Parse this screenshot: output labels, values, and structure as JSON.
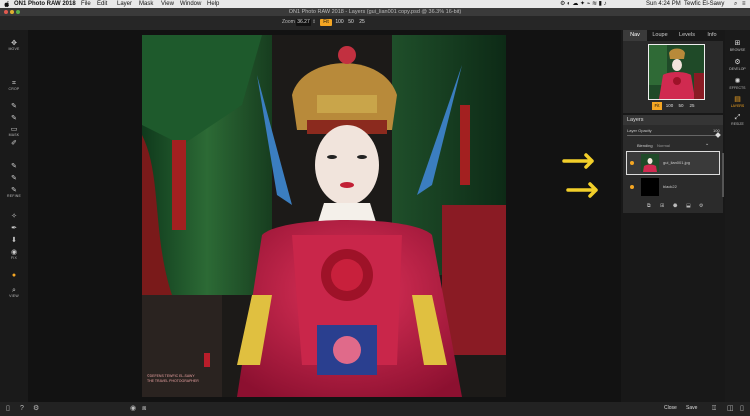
{
  "menubar": {
    "app": "ON1 Photo RAW 2018",
    "items": [
      "File",
      "Edit",
      "Layer",
      "Mask",
      "View",
      "Window",
      "Help"
    ],
    "clock": "Sun 4:24 PM",
    "user": "Tewfic El-Sawy"
  },
  "window": {
    "title": "ON1 Photo RAW 2018 - Layers (gui_lian001 copy.psd @ 36.3% 16-bit)"
  },
  "zoom": {
    "label": "Zoom",
    "value": "36.27",
    "fit": "Fit",
    "presets": [
      "100",
      "50",
      "25"
    ]
  },
  "tools": [
    {
      "glyph": "✥",
      "label": "MOVE"
    },
    {
      "glyph": "⌗",
      "label": "CROP"
    },
    {
      "glyph": "✎",
      "label": ""
    },
    {
      "glyph": "✎",
      "label": ""
    },
    {
      "glyph": "▭",
      "label": "MASK"
    },
    {
      "glyph": "✐",
      "label": ""
    },
    {
      "glyph": "✎",
      "label": ""
    },
    {
      "glyph": "✎",
      "label": ""
    },
    {
      "glyph": "✎",
      "label": "REFINE"
    },
    {
      "glyph": "✧",
      "label": ""
    },
    {
      "glyph": "✒",
      "label": ""
    },
    {
      "glyph": "⬇",
      "label": ""
    },
    {
      "glyph": "◉",
      "label": "FIX"
    },
    {
      "glyph": "●",
      "label": ""
    },
    {
      "glyph": "⌕",
      "label": "VIEW"
    }
  ],
  "panel": {
    "tabs": [
      "Nav",
      "Loupe",
      "Levels",
      "Info"
    ],
    "nav_zoom": [
      "Fit",
      "100",
      "50",
      "25"
    ],
    "layers_title": "Layers",
    "layer_opacity_label": "Layer Opacity",
    "layer_opacity_value": "100",
    "blending_label": "Blending",
    "blending_value": "Normal",
    "layers": [
      {
        "name": "gui_lian001.jpg"
      },
      {
        "name": "black22"
      }
    ]
  },
  "modules": [
    {
      "glyph": "⊞",
      "label": "BROWSE"
    },
    {
      "glyph": "⚙",
      "label": "DEVELOP"
    },
    {
      "glyph": "✺",
      "label": "EFFECTS"
    },
    {
      "glyph": "▤",
      "label": "LAYERS"
    },
    {
      "glyph": "⤢",
      "label": "RESIZE"
    }
  ],
  "bottom": {
    "close": "Close",
    "save": "Save"
  },
  "photo": {
    "watermark_line1": "©DEFENS TEWFIC EL-SAWY",
    "watermark_line2": "THE TRAVEL PHOTOGRAPHER"
  },
  "colors": {
    "accent": "#f5a623",
    "arrow_yellow": "#f2cf2a",
    "arrow_red": "#e8231f"
  }
}
